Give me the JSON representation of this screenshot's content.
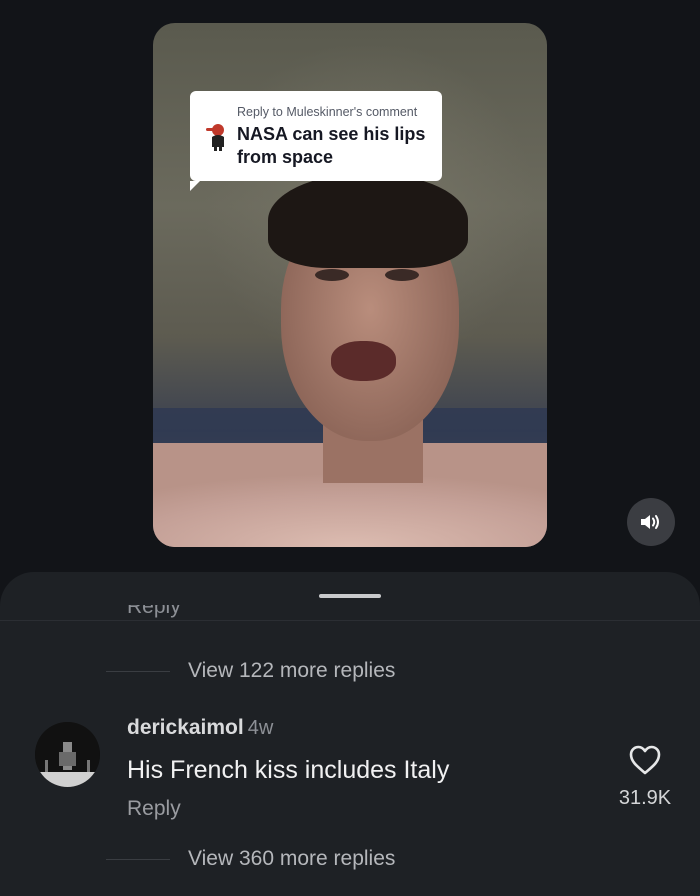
{
  "video": {
    "reply_meta": "Reply to Muleskinner's comment",
    "reply_text": "NASA can see his lips from space",
    "icons": {
      "sound": "speaker-icon",
      "avatar": "commenter-avatar-icon"
    }
  },
  "comments": {
    "cut_off_reply": "Reply",
    "view_more_top": "View 122 more replies",
    "comment": {
      "username": "derickaimol",
      "time": "4w",
      "text": "His French kiss includes Italy",
      "reply_label": "Reply",
      "likes": "31.9K",
      "like_icon": "heart-outline-icon"
    },
    "view_more_bottom": "View 360 more replies"
  },
  "colors": {
    "background": "#121418",
    "sheet": "#1e2125",
    "bubble": "#ffffff"
  }
}
